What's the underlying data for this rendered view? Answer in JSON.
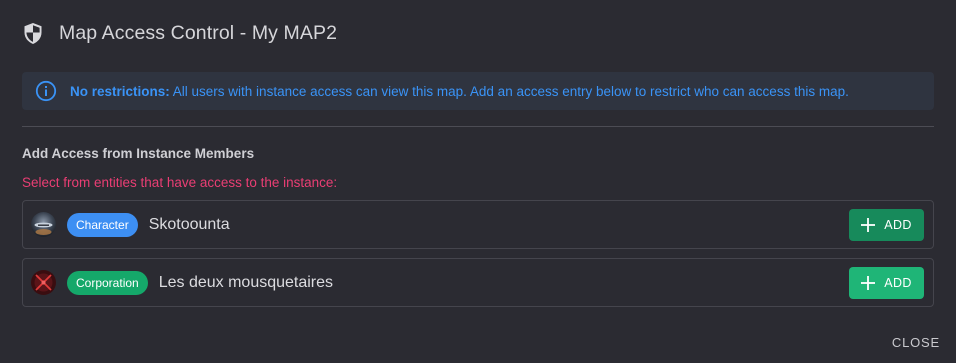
{
  "dialog": {
    "title": "Map Access Control - My MAP2",
    "title_icon": "shield-icon"
  },
  "info": {
    "icon": "info-circle-icon",
    "bold_label": "No restrictions:",
    "message": " All users with instance access can view this map. Add an access entry below to restrict who can access this map."
  },
  "section": {
    "title": "Add Access from Instance Members",
    "hint": "Select from entities that have access to the instance:"
  },
  "entities": [
    {
      "type_label": "Character",
      "name": "Skotoounta",
      "add_label": "ADD",
      "avatar": "character-portrait"
    },
    {
      "type_label": "Corporation",
      "name": "Les deux mousquetaires",
      "add_label": "ADD",
      "avatar": "corporation-logo"
    }
  ],
  "footer": {
    "close_label": "CLOSE"
  },
  "colors": {
    "background": "#2b2b32",
    "info_text": "#3a93f6",
    "hint_text": "#ea3e74",
    "character_chip": "#3d8ff3",
    "corporation_chip": "#15a86a",
    "add_button": "#1fb577"
  }
}
